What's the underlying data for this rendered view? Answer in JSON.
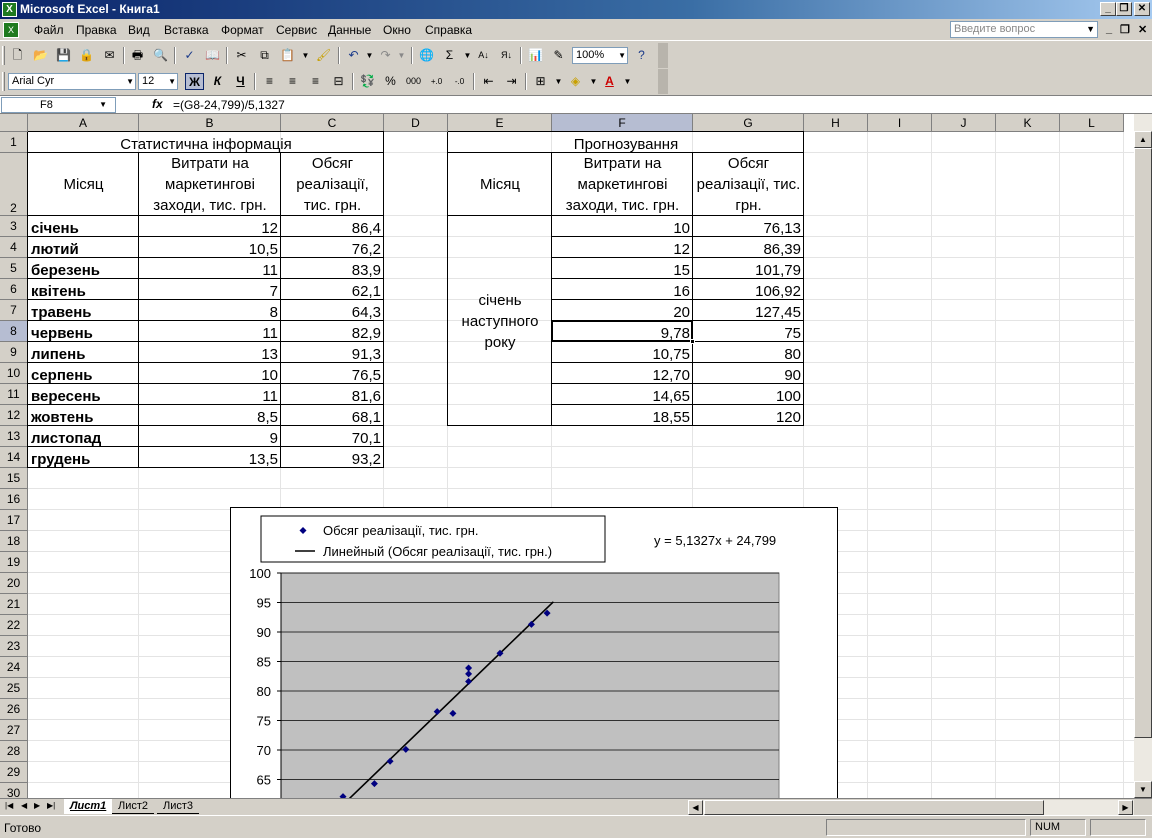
{
  "app": {
    "title": "Microsoft Excel - Книга1"
  },
  "menu": [
    "Файл",
    "Правка",
    "Вид",
    "Вставка",
    "Формат",
    "Сервис",
    "Данные",
    "Окно",
    "Справка"
  ],
  "help_placeholder": "Введите вопрос",
  "toolbar": {
    "zoom": "100%",
    "font": "Arial Cyr",
    "size": "12",
    "bold": "Ж",
    "italic": "К",
    "underline": "Ч",
    "percent": "%",
    "thousands": "000",
    "sigma": "Σ"
  },
  "formula_bar": {
    "name_box": "F8",
    "fx": "fx",
    "formula": "=(G8-24,799)/5,1327"
  },
  "columns": [
    "A",
    "B",
    "C",
    "D",
    "E",
    "F",
    "G",
    "H",
    "I",
    "J",
    "K",
    "L"
  ],
  "rows": [
    "1",
    "2",
    "3",
    "4",
    "5",
    "6",
    "7",
    "8",
    "9",
    "10",
    "11",
    "12",
    "13",
    "14",
    "15",
    "16",
    "17",
    "18",
    "19",
    "20",
    "21",
    "22",
    "23",
    "24",
    "25",
    "26",
    "27",
    "28",
    "29",
    "30"
  ],
  "stat": {
    "title": "Статистична інформація",
    "headers": [
      "Місяц",
      "Витрати на маркетингові заходи, тис. грн.",
      "Обсяг реалізації, тис. грн."
    ],
    "rows": [
      [
        "січень",
        "12",
        "86,4"
      ],
      [
        "лютий",
        "10,5",
        "76,2"
      ],
      [
        "березень",
        "11",
        "83,9"
      ],
      [
        "квітень",
        "7",
        "62,1"
      ],
      [
        "травень",
        "8",
        "64,3"
      ],
      [
        "червень",
        "11",
        "82,9"
      ],
      [
        "липень",
        "13",
        "91,3"
      ],
      [
        "серпень",
        "10",
        "76,5"
      ],
      [
        "вересень",
        "11",
        "81,6"
      ],
      [
        "жовтень",
        "8,5",
        "68,1"
      ],
      [
        "листопад",
        "9",
        "70,1"
      ],
      [
        "грудень",
        "13,5",
        "93,2"
      ]
    ]
  },
  "forecast": {
    "title": "Прогнозування",
    "headers": [
      "Місяц",
      "Витрати на маркетингові заходи, тис. грн.",
      "Обсяг реалізації, тис. грн."
    ],
    "month_label": "січень наступного року",
    "rows": [
      [
        "10",
        "76,13"
      ],
      [
        "12",
        "86,39"
      ],
      [
        "15",
        "101,79"
      ],
      [
        "16",
        "106,92"
      ],
      [
        "20",
        "127,45"
      ],
      [
        "9,78",
        "75"
      ],
      [
        "10,75",
        "80"
      ],
      [
        "12,70",
        "90"
      ],
      [
        "14,65",
        "100"
      ],
      [
        "18,55",
        "120"
      ]
    ]
  },
  "chart_data": {
    "type": "scatter",
    "legend": [
      "Обсяг реалізації, тис. грн.",
      "Линейный (Обсяг реалізації, тис. грн.)"
    ],
    "equation": "y = 5,1327x + 24,799",
    "x": [
      12,
      10.5,
      11,
      7,
      8,
      11,
      13,
      10,
      11,
      8.5,
      9,
      13.5
    ],
    "y": [
      86.4,
      76.2,
      83.9,
      62.1,
      64.3,
      82.9,
      91.3,
      76.5,
      81.6,
      68.1,
      70.1,
      93.2
    ],
    "trend": {
      "slope": 5.1327,
      "intercept": 24.799
    },
    "ylim": [
      65,
      100
    ],
    "yticks": [
      "100",
      "95",
      "90",
      "85",
      "80",
      "75",
      "70",
      "65"
    ],
    "series_color": "#000080",
    "plot_bg": "#c0c0c0",
    "grid": true,
    "legend_position": "top-left"
  },
  "sheets": [
    "Лист1",
    "Лист2",
    "Лист3"
  ],
  "status": {
    "text": "Готово",
    "num": "NUM"
  }
}
